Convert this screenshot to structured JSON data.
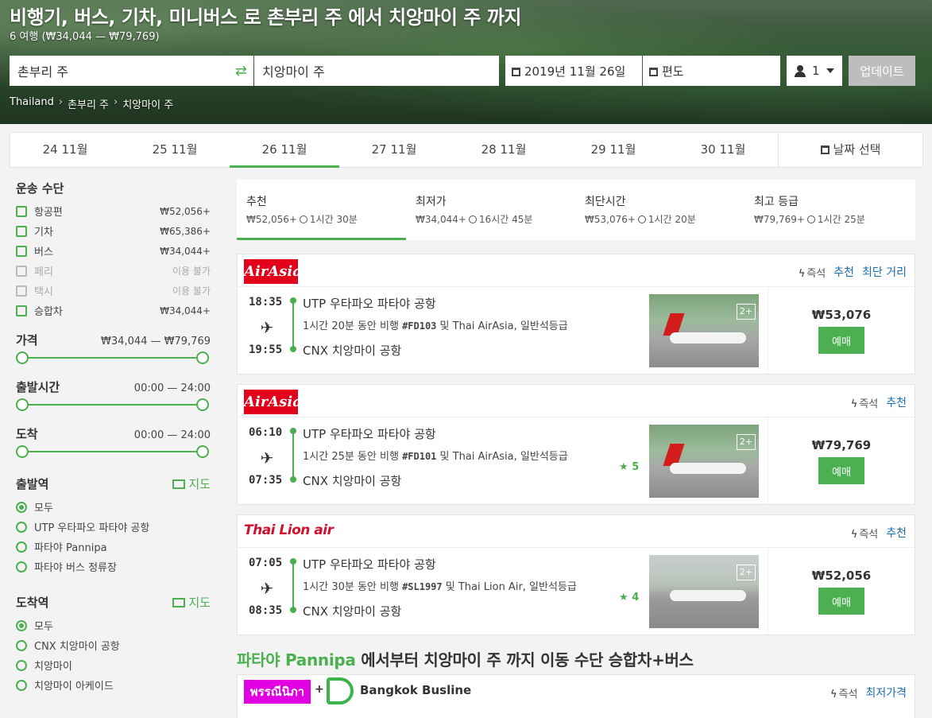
{
  "header": {
    "title": "비행기, 버스, 기차, 미니버스 로 촌부리 주 에서 치앙마이 주 까지",
    "subtitle": "6 여행 (₩34,044 — ₩79,769)"
  },
  "search": {
    "from": "촌부리 주",
    "to": "치앙마이 주",
    "date": "2019년 11월 26일",
    "return": "편도",
    "passengers": "1",
    "update_label": "업데이트"
  },
  "breadcrumb": [
    "Thailand",
    "촌부리 주",
    "치앙마이 주"
  ],
  "dates": {
    "tabs": [
      "24 11월",
      "25 11월",
      "26 11월",
      "27 11월",
      "28 11월",
      "29 11월",
      "30 11월"
    ],
    "active_index": 2,
    "picker_label": "날짜 선택"
  },
  "sidebar": {
    "transport_title": "운송 수단",
    "transport": [
      {
        "label": "항공편",
        "price": "₩52,056+",
        "enabled": true
      },
      {
        "label": "기차",
        "price": "₩65,386+",
        "enabled": true
      },
      {
        "label": "버스",
        "price": "₩34,044+",
        "enabled": true
      },
      {
        "label": "페리",
        "price": "이용 불가",
        "enabled": false
      },
      {
        "label": "택시",
        "price": "이용 불가",
        "enabled": false
      },
      {
        "label": "승합차",
        "price": "₩34,044+",
        "enabled": true
      }
    ],
    "price_title": "가격",
    "price_range": "₩34,044 — ₩79,769",
    "depart_title": "출발시간",
    "depart_range": "00:00 — 24:00",
    "arrive_title": "도착",
    "arrive_range": "00:00 — 24:00",
    "from_station_title": "출발역",
    "map_label": "지도",
    "from_stations": [
      "모두",
      "UTP 우타파오 파타야 공항",
      "파타야 Pannipa",
      "파타야 버스 정류장"
    ],
    "to_station_title": "도착역",
    "to_stations": [
      "모두",
      "CNX 치앙마이 공항",
      "치앙마이",
      "치앙마이 아케이드"
    ]
  },
  "sort_tabs": [
    {
      "name": "추천",
      "price": "₩52,056+",
      "duration": "1시간 30분"
    },
    {
      "name": "최저가",
      "price": "₩34,044+",
      "duration": "16시간 45분"
    },
    {
      "name": "최단시간",
      "price": "₩53,076+",
      "duration": "1시간 20분"
    },
    {
      "name": "최고 등급",
      "price": "₩79,769+",
      "duration": "1시간 25분"
    }
  ],
  "results": [
    {
      "logo": "AirAsia",
      "tags": [
        "즉석",
        "추천",
        "최단 거리"
      ],
      "dep_time": "18:35",
      "arr_time": "19:55",
      "from": "UTP 우타파오 파타야 공항",
      "desc_pre": "1시간 20분 동안 비행 ",
      "flight": "#FD103",
      "desc_post": " 및 Thai AirAsia, 일반석등급",
      "to": "CNX 치앙마이 공항",
      "rating": "",
      "photos": "2+",
      "price": "₩53,076",
      "book": "예매"
    },
    {
      "logo": "AirAsia",
      "tags": [
        "즉석",
        "추천"
      ],
      "dep_time": "06:10",
      "arr_time": "07:35",
      "from": "UTP 우타파오 파타야 공항",
      "desc_pre": "1시간 25분 동안 비행 ",
      "flight": "#FD101",
      "desc_post": " 및 Thai AirAsia, 일반석등급",
      "to": "CNX 치앙마이 공항",
      "rating": "5",
      "photos": "2+",
      "price": "₩79,769",
      "book": "예매"
    },
    {
      "logo": "Thai Lion air",
      "tags": [
        "즉석",
        "추천"
      ],
      "dep_time": "07:05",
      "arr_time": "08:35",
      "from": "UTP 우타파오 파타야 공항",
      "desc_pre": "1시간 30분 동안 비행 ",
      "flight": "#SL1997",
      "desc_post": " 및 Thai Lion Air, 일반석등급",
      "to": "CNX 치앙마이 공항",
      "rating": "4",
      "photos": "2+",
      "price": "₩52,056",
      "book": "예매"
    }
  ],
  "section": {
    "pre": "파타야 Pannipa",
    "post": " 에서부터 치앙마이 주 까지 이동 수단 승합차+버스"
  },
  "bus_card": {
    "logo1": "พรรณีนิภา",
    "plus": "+",
    "logo2": "Bangkok Busline",
    "tags": [
      "즉석",
      "최저가격"
    ]
  }
}
